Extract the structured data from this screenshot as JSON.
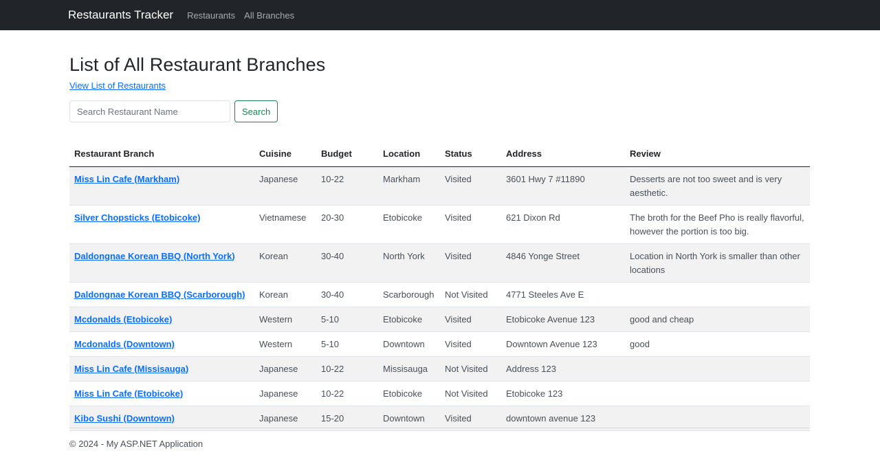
{
  "nav": {
    "brand": "Restaurants Tracker",
    "links": [
      "Restaurants",
      "All Branches"
    ]
  },
  "page": {
    "title": "List of All Restaurant Branches",
    "view_link": "View List of Restaurants"
  },
  "search": {
    "placeholder": "Search Restaurant Name",
    "value": "",
    "button_label": "Search"
  },
  "table": {
    "headers": [
      "Restaurant Branch",
      "Cuisine",
      "Budget",
      "Location",
      "Status",
      "Address",
      "Review"
    ],
    "rows": [
      [
        "Miss Lin Cafe (Markham)",
        "Japanese",
        "10-22",
        "Markham",
        "Visited",
        "3601 Hwy 7 #11890",
        "Desserts are not too sweet and is very aesthetic."
      ],
      [
        "Silver Chopsticks (Etobicoke)",
        "Vietnamese",
        "20-30",
        "Etobicoke",
        "Visited",
        "621 Dixon Rd",
        "The broth for the Beef Pho is really flavorful, however the portion is too big."
      ],
      [
        "Daldongnae Korean BBQ (North York)",
        "Korean",
        "30-40",
        "North York",
        "Visited",
        "4846 Yonge Street",
        "Location in North York is smaller than other locations"
      ],
      [
        "Daldongnae Korean BBQ (Scarborough)",
        "Korean",
        "30-40",
        "Scarborough",
        "Not Visited",
        "4771 Steeles Ave E",
        ""
      ],
      [
        "Mcdonalds (Etobicoke)",
        "Western",
        "5-10",
        "Etobicoke",
        "Visited",
        "Etobicoke Avenue 123",
        "good and cheap"
      ],
      [
        "Mcdonalds (Downtown)",
        "Western",
        "5-10",
        "Downtown",
        "Visited",
        "Downtown Avenue 123",
        "good"
      ],
      [
        "Miss Lin Cafe (Missisauga)",
        "Japanese",
        "10-22",
        "Missisauga",
        "Not Visited",
        "Address 123",
        ""
      ],
      [
        "Miss Lin Cafe (Etobicoke)",
        "Japanese",
        "10-22",
        "Etobicoke",
        "Not Visited",
        "Etobicoke 123",
        ""
      ],
      [
        "Kibo Sushi (Downtown)",
        "Japanese",
        "15-20",
        "Downtown",
        "Visited",
        "downtown avenue 123",
        ""
      ]
    ]
  },
  "footer": {
    "text": "© 2024 - My ASP.NET Application"
  },
  "colors": {
    "navbar": "#212529",
    "link": "#0d6efd",
    "search_button": "#198754",
    "stripe": "#f2f2f2"
  }
}
